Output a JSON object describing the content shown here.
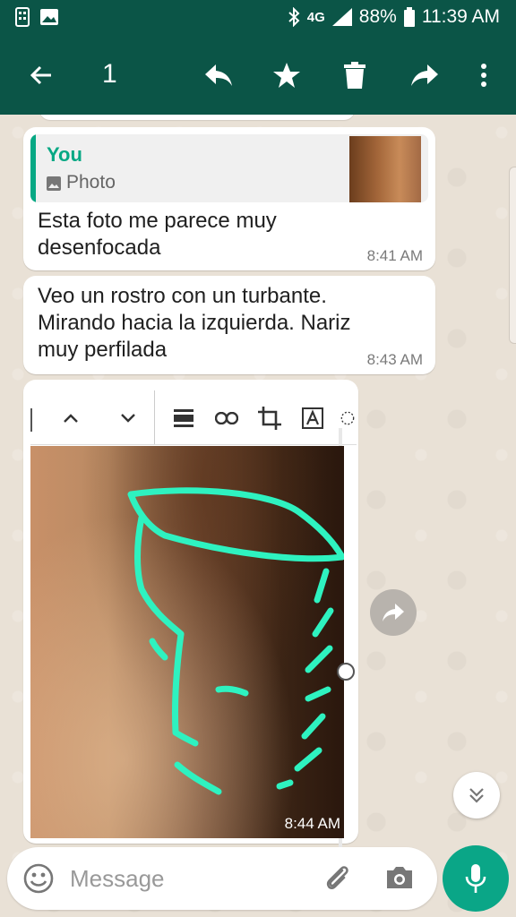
{
  "status_bar": {
    "network": "4G",
    "battery": "88%",
    "time": "11:39 AM"
  },
  "app_bar": {
    "selected_count": "1"
  },
  "messages": [
    {
      "quote_author": "You",
      "quote_type": "Photo",
      "text": "Esta foto me parece muy desenfocada",
      "time": "8:41 AM"
    },
    {
      "text": "Veo un rostro con un turbante. Mirando hacia la izquierda. Nariz muy perfilada",
      "time": "8:43 AM"
    },
    {
      "type": "image",
      "time": "8:44 AM"
    }
  ],
  "composer": {
    "placeholder": "Message"
  },
  "colors": {
    "header": "#0b5547",
    "accent": "#07a884",
    "mic": "#0aa687",
    "drawing": "#2ef2c0"
  }
}
